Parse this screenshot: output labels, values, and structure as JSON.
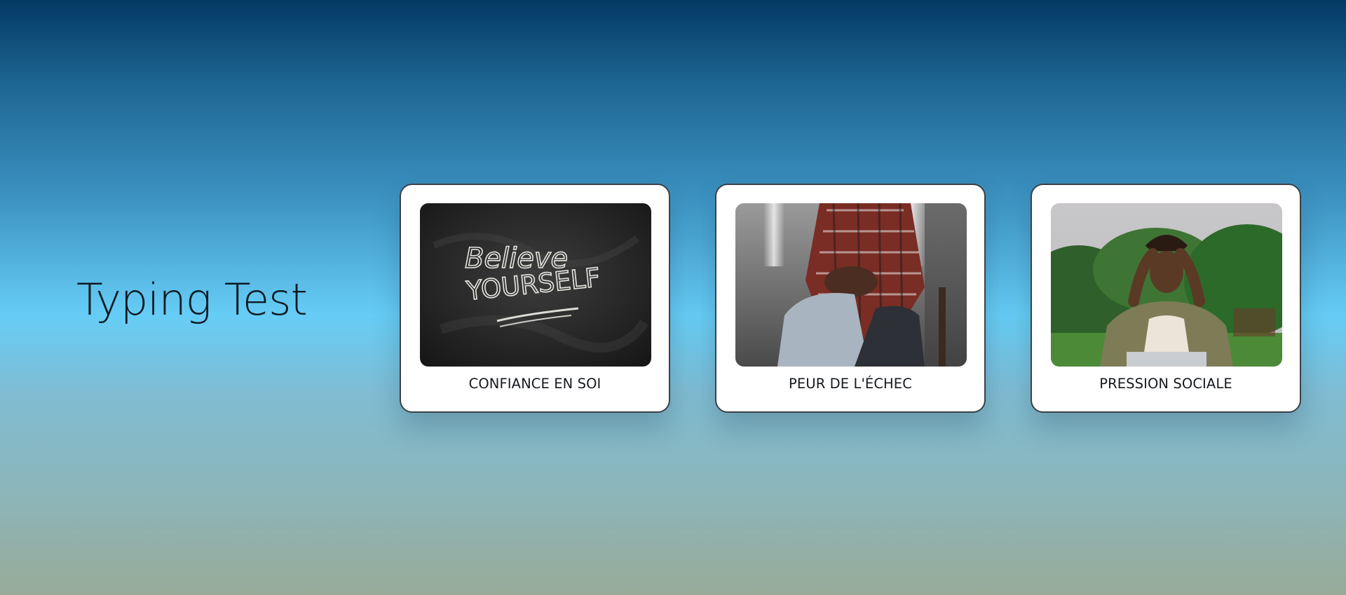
{
  "app": {
    "title": "Typing Test"
  },
  "cards": [
    {
      "label": "CONFIANCE EN SOI",
      "image": "chalkboard-believe-yourself",
      "chalk_line1": "Believe",
      "chalk_line2": "YOURSELF"
    },
    {
      "label": "PEUR DE L'ÉCHEC",
      "image": "person-hugging-knees"
    },
    {
      "label": "PRESSION SOCIALE",
      "image": "stressed-man-with-laptop"
    }
  ],
  "colors": {
    "card_background": "#ffffff",
    "card_border": "#3b4148",
    "title_text": "#0e1a22",
    "gradient_top": "#033a63",
    "gradient_middle": "#66cdf6",
    "gradient_bottom": "#98ab98"
  }
}
